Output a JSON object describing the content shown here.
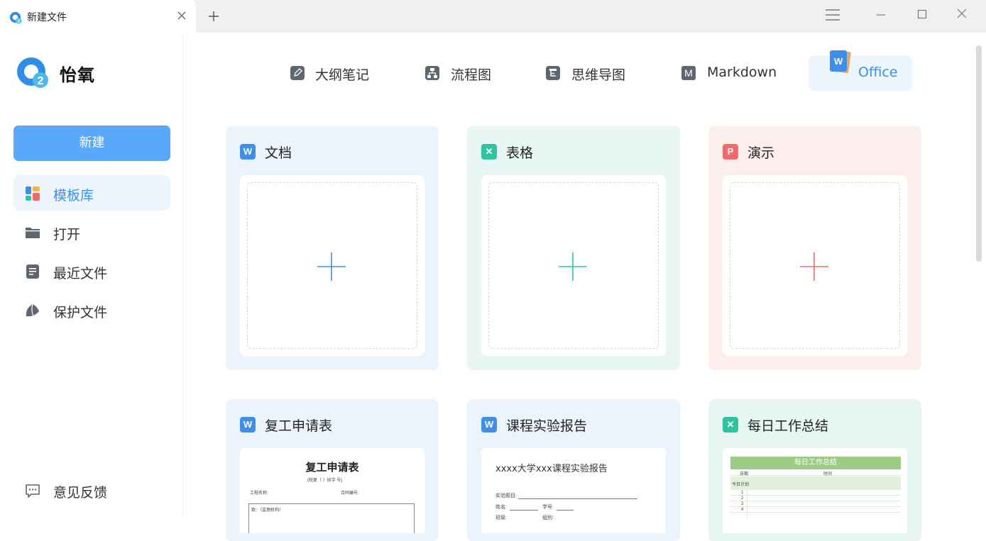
{
  "window": {
    "tab_title": "新建文件",
    "icons": {
      "logo": "app-logo-icon",
      "close": "close-icon",
      "add": "plus-icon",
      "menu": "hamburger-menu-icon",
      "minimize": "minimize-icon",
      "maximize": "maximize-icon",
      "win_close": "close-icon"
    }
  },
  "sidebar": {
    "brand_name": "怡氧",
    "new_button": "新建",
    "items": [
      {
        "label": "模板库",
        "icon": "template-grid-icon",
        "active": true
      },
      {
        "label": "打开",
        "icon": "folder-icon",
        "active": false
      },
      {
        "label": "最近文件",
        "icon": "recent-doc-icon",
        "active": false
      },
      {
        "label": "保护文件",
        "icon": "protect-shield-icon",
        "active": false
      }
    ],
    "feedback": "意见反馈"
  },
  "type_tabs": [
    {
      "label": "大纲笔记",
      "icon": "outline-note-icon",
      "selected": false
    },
    {
      "label": "流程图",
      "icon": "flowchart-icon",
      "selected": false
    },
    {
      "label": "思维导图",
      "icon": "mindmap-icon",
      "selected": false
    },
    {
      "label": "Markdown",
      "icon": "markdown-icon",
      "selected": false
    },
    {
      "label": "Office",
      "icon": "office-word-icon",
      "selected": true
    }
  ],
  "new_cards": [
    {
      "title": "文档",
      "badge": "W",
      "color": "#3d8fe7"
    },
    {
      "title": "表格",
      "badge": "✕",
      "color": "#2ec4a0"
    },
    {
      "title": "演示",
      "badge": "P",
      "color": "#ef6b6b"
    }
  ],
  "templates": [
    {
      "title": "复工申请表",
      "badge": "W",
      "preview": {
        "heading": "复工申请表",
        "sub": "(皖复〔    〕技字    号)",
        "left_field": "工程名称:",
        "right_field": "合同编号:",
        "box_text": "致：（监理机构）"
      }
    },
    {
      "title": "课程实验报告",
      "badge": "W",
      "preview": {
        "heading": "xxxx大学xxx课程实验报告",
        "line1": "实验题目:",
        "name_label": "姓名:",
        "id_label": "学号:",
        "line3a": "班级:",
        "line3b": "组别:"
      }
    },
    {
      "title": "每日工作总结",
      "badge": "✕",
      "preview": {
        "heading": "每日工作总结",
        "col_date": "日期",
        "col_time": "时间",
        "plan": "今日计划",
        "rows": [
          "1",
          "2",
          "3",
          "4"
        ]
      }
    }
  ],
  "colors": {
    "accent": "#5aa8fa",
    "word": "#3d8fe7",
    "sheet": "#2ec4a0",
    "ppt": "#ef6b6b"
  }
}
